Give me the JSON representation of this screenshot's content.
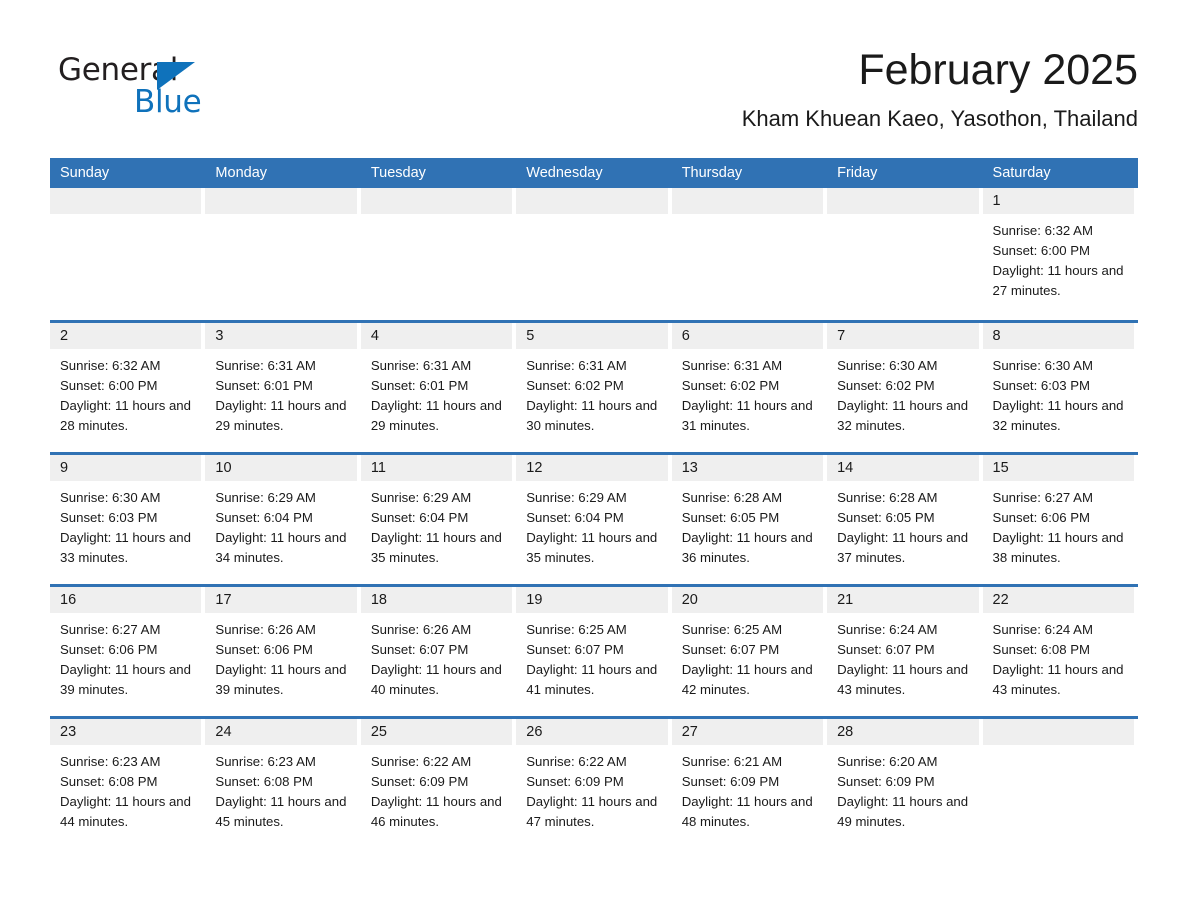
{
  "brand": {
    "name_part1": "General",
    "name_part2": "Blue",
    "triangle_color": "#0f72bb",
    "accent_color": "#3072b4"
  },
  "header": {
    "month_title": "February 2025",
    "location": "Kham Khuean Kaeo, Yasothon, Thailand"
  },
  "calendar": {
    "weekdays": [
      "Sunday",
      "Monday",
      "Tuesday",
      "Wednesday",
      "Thursday",
      "Friday",
      "Saturday"
    ],
    "weeks": [
      [
        {
          "day": "",
          "sunrise": "",
          "sunset": "",
          "daylight": "",
          "empty": true
        },
        {
          "day": "",
          "sunrise": "",
          "sunset": "",
          "daylight": "",
          "empty": true
        },
        {
          "day": "",
          "sunrise": "",
          "sunset": "",
          "daylight": "",
          "empty": true
        },
        {
          "day": "",
          "sunrise": "",
          "sunset": "",
          "daylight": "",
          "empty": true
        },
        {
          "day": "",
          "sunrise": "",
          "sunset": "",
          "daylight": "",
          "empty": true
        },
        {
          "day": "",
          "sunrise": "",
          "sunset": "",
          "daylight": "",
          "empty": true
        },
        {
          "day": "1",
          "sunrise": "Sunrise: 6:32 AM",
          "sunset": "Sunset: 6:00 PM",
          "daylight": "Daylight: 11 hours and 27 minutes.",
          "empty": false
        }
      ],
      [
        {
          "day": "2",
          "sunrise": "Sunrise: 6:32 AM",
          "sunset": "Sunset: 6:00 PM",
          "daylight": "Daylight: 11 hours and 28 minutes.",
          "empty": false
        },
        {
          "day": "3",
          "sunrise": "Sunrise: 6:31 AM",
          "sunset": "Sunset: 6:01 PM",
          "daylight": "Daylight: 11 hours and 29 minutes.",
          "empty": false
        },
        {
          "day": "4",
          "sunrise": "Sunrise: 6:31 AM",
          "sunset": "Sunset: 6:01 PM",
          "daylight": "Daylight: 11 hours and 29 minutes.",
          "empty": false
        },
        {
          "day": "5",
          "sunrise": "Sunrise: 6:31 AM",
          "sunset": "Sunset: 6:02 PM",
          "daylight": "Daylight: 11 hours and 30 minutes.",
          "empty": false
        },
        {
          "day": "6",
          "sunrise": "Sunrise: 6:31 AM",
          "sunset": "Sunset: 6:02 PM",
          "daylight": "Daylight: 11 hours and 31 minutes.",
          "empty": false
        },
        {
          "day": "7",
          "sunrise": "Sunrise: 6:30 AM",
          "sunset": "Sunset: 6:02 PM",
          "daylight": "Daylight: 11 hours and 32 minutes.",
          "empty": false
        },
        {
          "day": "8",
          "sunrise": "Sunrise: 6:30 AM",
          "sunset": "Sunset: 6:03 PM",
          "daylight": "Daylight: 11 hours and 32 minutes.",
          "empty": false
        }
      ],
      [
        {
          "day": "9",
          "sunrise": "Sunrise: 6:30 AM",
          "sunset": "Sunset: 6:03 PM",
          "daylight": "Daylight: 11 hours and 33 minutes.",
          "empty": false
        },
        {
          "day": "10",
          "sunrise": "Sunrise: 6:29 AM",
          "sunset": "Sunset: 6:04 PM",
          "daylight": "Daylight: 11 hours and 34 minutes.",
          "empty": false
        },
        {
          "day": "11",
          "sunrise": "Sunrise: 6:29 AM",
          "sunset": "Sunset: 6:04 PM",
          "daylight": "Daylight: 11 hours and 35 minutes.",
          "empty": false
        },
        {
          "day": "12",
          "sunrise": "Sunrise: 6:29 AM",
          "sunset": "Sunset: 6:04 PM",
          "daylight": "Daylight: 11 hours and 35 minutes.",
          "empty": false
        },
        {
          "day": "13",
          "sunrise": "Sunrise: 6:28 AM",
          "sunset": "Sunset: 6:05 PM",
          "daylight": "Daylight: 11 hours and 36 minutes.",
          "empty": false
        },
        {
          "day": "14",
          "sunrise": "Sunrise: 6:28 AM",
          "sunset": "Sunset: 6:05 PM",
          "daylight": "Daylight: 11 hours and 37 minutes.",
          "empty": false
        },
        {
          "day": "15",
          "sunrise": "Sunrise: 6:27 AM",
          "sunset": "Sunset: 6:06 PM",
          "daylight": "Daylight: 11 hours and 38 minutes.",
          "empty": false
        }
      ],
      [
        {
          "day": "16",
          "sunrise": "Sunrise: 6:27 AM",
          "sunset": "Sunset: 6:06 PM",
          "daylight": "Daylight: 11 hours and 39 minutes.",
          "empty": false
        },
        {
          "day": "17",
          "sunrise": "Sunrise: 6:26 AM",
          "sunset": "Sunset: 6:06 PM",
          "daylight": "Daylight: 11 hours and 39 minutes.",
          "empty": false
        },
        {
          "day": "18",
          "sunrise": "Sunrise: 6:26 AM",
          "sunset": "Sunset: 6:07 PM",
          "daylight": "Daylight: 11 hours and 40 minutes.",
          "empty": false
        },
        {
          "day": "19",
          "sunrise": "Sunrise: 6:25 AM",
          "sunset": "Sunset: 6:07 PM",
          "daylight": "Daylight: 11 hours and 41 minutes.",
          "empty": false
        },
        {
          "day": "20",
          "sunrise": "Sunrise: 6:25 AM",
          "sunset": "Sunset: 6:07 PM",
          "daylight": "Daylight: 11 hours and 42 minutes.",
          "empty": false
        },
        {
          "day": "21",
          "sunrise": "Sunrise: 6:24 AM",
          "sunset": "Sunset: 6:07 PM",
          "daylight": "Daylight: 11 hours and 43 minutes.",
          "empty": false
        },
        {
          "day": "22",
          "sunrise": "Sunrise: 6:24 AM",
          "sunset": "Sunset: 6:08 PM",
          "daylight": "Daylight: 11 hours and 43 minutes.",
          "empty": false
        }
      ],
      [
        {
          "day": "23",
          "sunrise": "Sunrise: 6:23 AM",
          "sunset": "Sunset: 6:08 PM",
          "daylight": "Daylight: 11 hours and 44 minutes.",
          "empty": false
        },
        {
          "day": "24",
          "sunrise": "Sunrise: 6:23 AM",
          "sunset": "Sunset: 6:08 PM",
          "daylight": "Daylight: 11 hours and 45 minutes.",
          "empty": false
        },
        {
          "day": "25",
          "sunrise": "Sunrise: 6:22 AM",
          "sunset": "Sunset: 6:09 PM",
          "daylight": "Daylight: 11 hours and 46 minutes.",
          "empty": false
        },
        {
          "day": "26",
          "sunrise": "Sunrise: 6:22 AM",
          "sunset": "Sunset: 6:09 PM",
          "daylight": "Daylight: 11 hours and 47 minutes.",
          "empty": false
        },
        {
          "day": "27",
          "sunrise": "Sunrise: 6:21 AM",
          "sunset": "Sunset: 6:09 PM",
          "daylight": "Daylight: 11 hours and 48 minutes.",
          "empty": false
        },
        {
          "day": "28",
          "sunrise": "Sunrise: 6:20 AM",
          "sunset": "Sunset: 6:09 PM",
          "daylight": "Daylight: 11 hours and 49 minutes.",
          "empty": false
        },
        {
          "day": "",
          "sunrise": "",
          "sunset": "",
          "daylight": "",
          "empty": true
        }
      ]
    ]
  }
}
